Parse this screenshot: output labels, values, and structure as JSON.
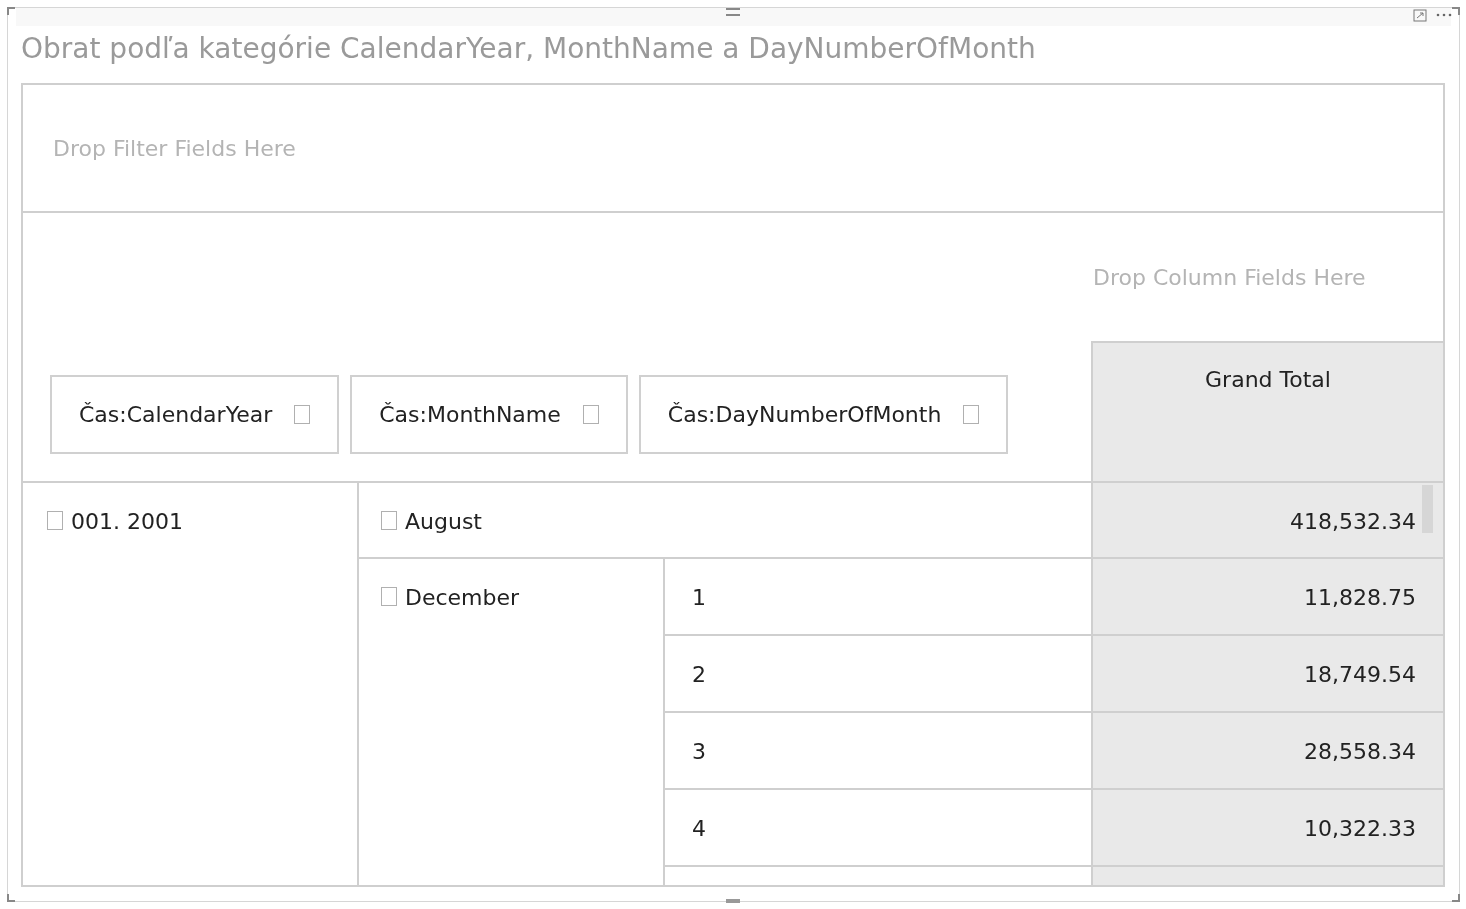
{
  "title": "Obrat podľa kategórie CalendarYear, MonthName a DayNumberOfMonth",
  "filter_area": {
    "placeholder": "Drop Filter Fields Here"
  },
  "column_area": {
    "placeholder": "Drop Column Fields Here"
  },
  "row_fields": [
    {
      "label": "Čas:CalendarYear"
    },
    {
      "label": "Čas:MonthName"
    },
    {
      "label": "Čas:DayNumberOfMonth"
    }
  ],
  "grand_total_header": "Grand Total",
  "rows": [
    {
      "label": "001. 2001",
      "children": [
        {
          "label": "August",
          "total": "418,532.34"
        },
        {
          "label": "December",
          "children": [
            {
              "label": "1",
              "total": "11,828.75"
            },
            {
              "label": "2",
              "total": "18,749.54"
            },
            {
              "label": "3",
              "total": "28,558.34"
            },
            {
              "label": "4",
              "total": "10,322.33"
            }
          ]
        }
      ]
    }
  ]
}
